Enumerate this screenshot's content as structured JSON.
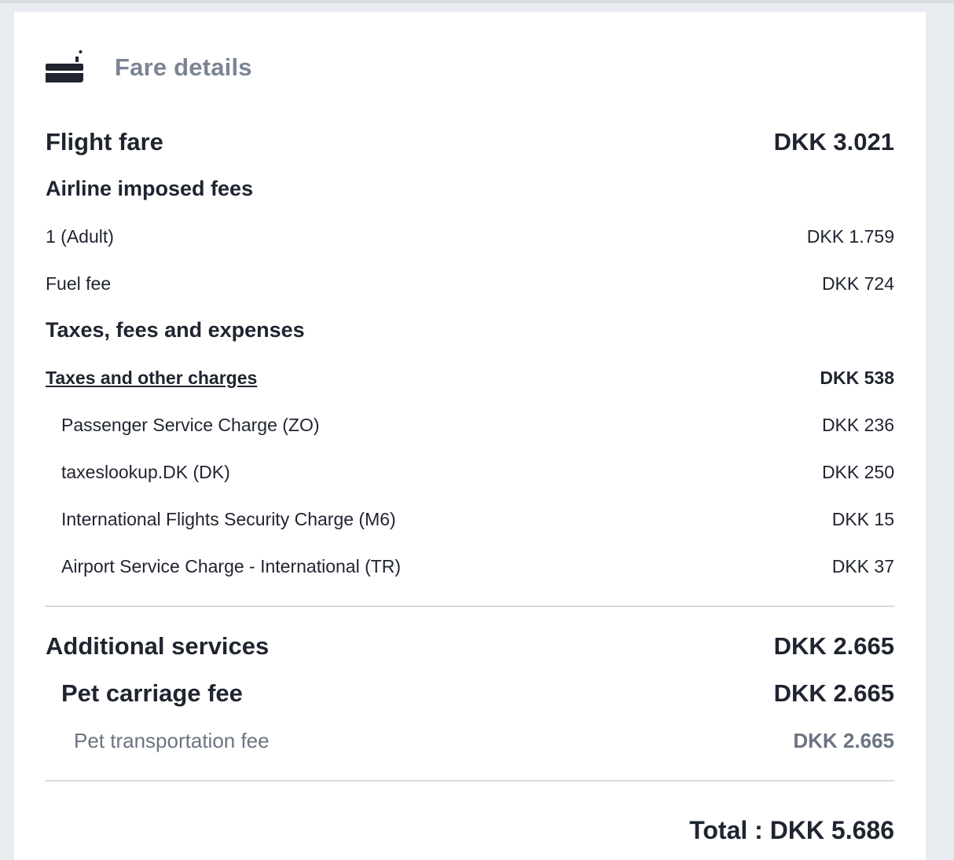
{
  "header": {
    "title": "Fare details",
    "icon": "boarding-pass-icon"
  },
  "flight_fare": {
    "label": "Flight fare",
    "amount": "DKK 3.021"
  },
  "airline_fees": {
    "heading": "Airline imposed fees",
    "items": [
      {
        "label": "1 (Adult)",
        "amount": "DKK 1.759"
      },
      {
        "label": "Fuel fee",
        "amount": "DKK 724"
      }
    ]
  },
  "taxes": {
    "heading": "Taxes, fees and expenses",
    "subheading": {
      "label": "Taxes and other charges",
      "amount": "DKK 538"
    },
    "items": [
      {
        "label": "Passenger Service Charge (ZO)",
        "amount": "DKK 236"
      },
      {
        "label": "taxeslookup.DK (DK)",
        "amount": "DKK 250"
      },
      {
        "label": "International Flights Security Charge (M6)",
        "amount": "DKK 15"
      },
      {
        "label": "Airport Service Charge - International (TR)",
        "amount": "DKK 37"
      }
    ]
  },
  "additional_services": {
    "label": "Additional services",
    "amount": "DKK 2.665",
    "group": {
      "label": "Pet carriage fee",
      "amount": "DKK 2.665",
      "item": {
        "label": "Pet transportation fee",
        "amount": "DKK 2.665"
      }
    }
  },
  "total": {
    "text": "Total : DKK 5.686"
  },
  "colors": {
    "text": "#1f2430",
    "muted": "#6b7482",
    "header_title": "#7b8494",
    "divider": "#d6d9de",
    "page_bg": "#e8ebf0",
    "card_bg": "#ffffff"
  }
}
